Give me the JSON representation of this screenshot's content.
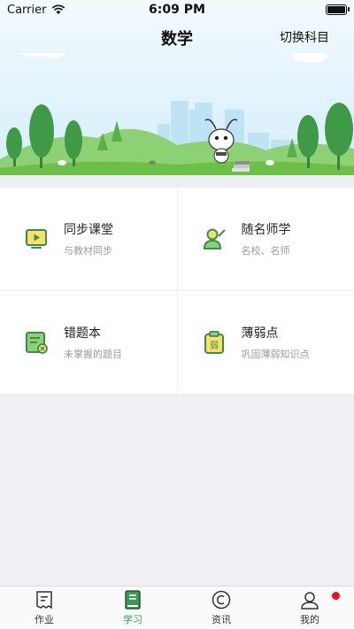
{
  "status_bar": {
    "carrier": "Carrier",
    "time": "6:09 PM"
  },
  "header": {
    "title": "数学",
    "switch_label": "切换科目"
  },
  "cards": [
    {
      "title": "同步课堂",
      "subtitle": "与教材同步",
      "icon": "video-lesson-icon"
    },
    {
      "title": "随名师学",
      "subtitle": "名校、名师",
      "icon": "teacher-icon"
    },
    {
      "title": "错题本",
      "subtitle": "未掌握的题目",
      "icon": "wrong-answers-book-icon"
    },
    {
      "title": "薄弱点",
      "subtitle": "巩固薄弱知识点",
      "icon": "weak-points-clipboard-icon",
      "icon_text": "弱"
    }
  ],
  "tabbar": {
    "items": [
      {
        "label": "作业",
        "icon": "homework-icon"
      },
      {
        "label": "学习",
        "icon": "study-book-icon",
        "active": true
      },
      {
        "label": "资讯",
        "icon": "news-icon"
      },
      {
        "label": "我的",
        "icon": "profile-icon",
        "badge": true
      }
    ]
  },
  "colors": {
    "accent": "#3a9a4f",
    "badge": "#e8111d",
    "hill": "#6cc04a",
    "icon_green": "#3e8b4f",
    "icon_yellow": "#f7e16b"
  }
}
